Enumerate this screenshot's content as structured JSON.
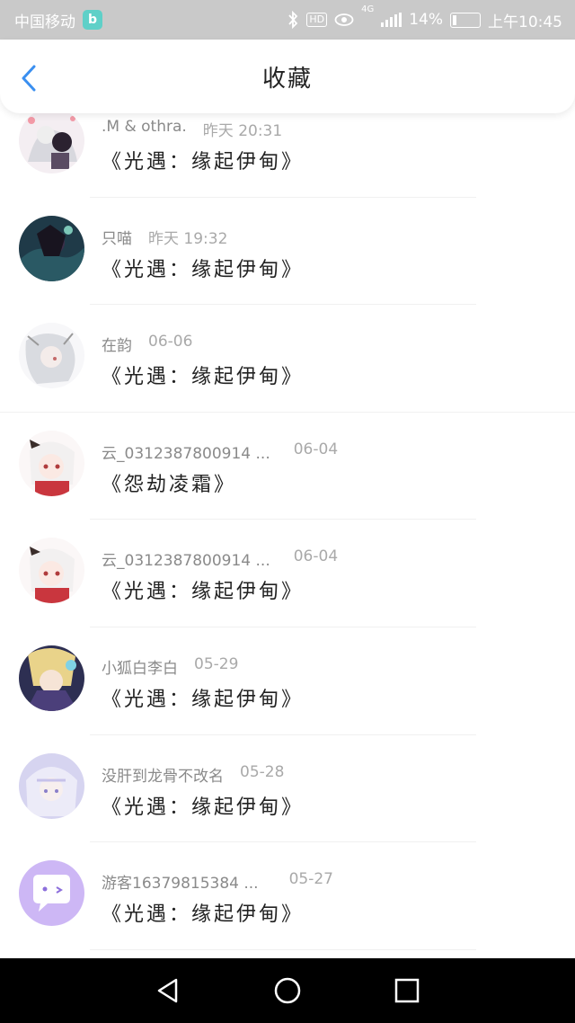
{
  "status_bar": {
    "carrier": "中国移动",
    "app_badge": "b",
    "hd": "HD",
    "network": "4G",
    "battery_percent": "14%",
    "battery_level": 0.14,
    "time": "上午10:45"
  },
  "header": {
    "title": "收藏",
    "back_icon": "chevron-left-icon",
    "accent_color": "#3a8ff0"
  },
  "favorites": [
    {
      "name": ".M & othra.",
      "time": "昨天 20:31",
      "title": "《光遇：缘起伊甸》",
      "avatar": "anime-avatar-1"
    },
    {
      "name": "只喵",
      "time": "昨天 19:32",
      "title": "《光遇：缘起伊甸》",
      "avatar": "anime-avatar-2"
    },
    {
      "name": "在韵",
      "time": "06-06",
      "title": "《光遇：缘起伊甸》",
      "avatar": "anime-avatar-3"
    },
    {
      "name": "云_0312387800914 ...",
      "time": "06-04",
      "title": "《怨劫凌霜》",
      "avatar": "anime-avatar-4"
    },
    {
      "name": "云_0312387800914 ...",
      "time": "06-04",
      "title": "《光遇：缘起伊甸》",
      "avatar": "anime-avatar-5"
    },
    {
      "name": "小狐白李白",
      "time": "05-29",
      "title": "《光遇：缘起伊甸》",
      "avatar": "anime-avatar-6"
    },
    {
      "name": "没肝到龙骨不改名",
      "time": "05-28",
      "title": "《光遇：缘起伊甸》",
      "avatar": "anime-avatar-7"
    },
    {
      "name": "游客16379815384 ...",
      "time": "05-27",
      "title": "《光遇：缘起伊甸》",
      "avatar": "chat-bubble-avatar"
    }
  ],
  "system_nav": {
    "back_icon": "triangle-back-icon",
    "home_icon": "circle-home-icon",
    "recents_icon": "square-recents-icon"
  }
}
